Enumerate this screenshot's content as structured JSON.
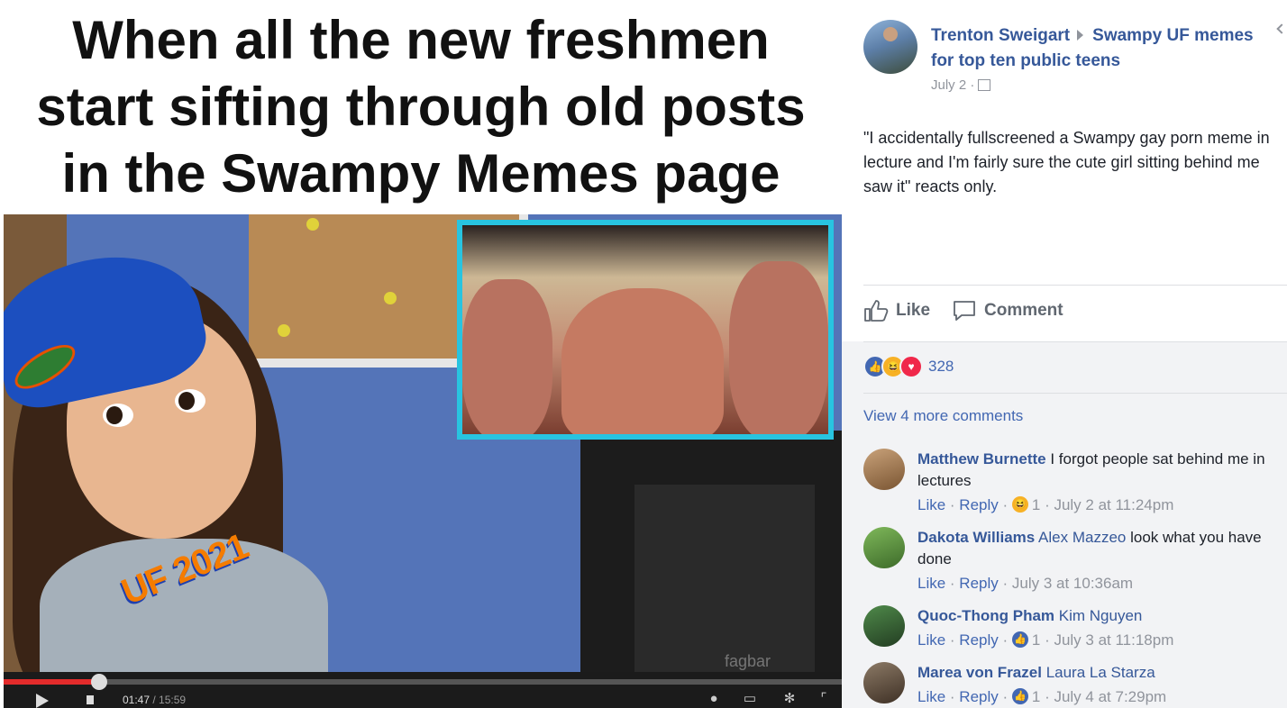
{
  "meme": {
    "caption_lines": [
      "When all the new freshmen",
      "start sifting through old posts",
      "in the Swampy Memes page"
    ],
    "shirt_text": "UF 2021",
    "watermark": "fagbar",
    "video": {
      "current_time": "01:47",
      "duration": "/ 15:59",
      "progress": 0.114
    }
  },
  "post": {
    "author": "Trenton Sweigart",
    "group": "Swampy UF memes for top ten public teens",
    "date": "July 2 ·",
    "text": "\"I accidentally fullscreened a Swampy gay porn meme in lecture and I'm fairly sure the cute girl sitting behind me saw it\" reacts only.",
    "actions": {
      "like": "Like",
      "comment": "Comment"
    },
    "reaction_count": "328",
    "reaction_icons": [
      "like-reaction-icon",
      "haha-reaction-icon",
      "love-reaction-icon"
    ],
    "view_more": "View 4 more comments"
  },
  "colors": {
    "link": "#365899",
    "accent": "#4267b2",
    "meta": "#90949c",
    "like_blue": "#4267b2",
    "love_red": "#f0284a",
    "haha_yellow": "#f7b125"
  },
  "comments": [
    {
      "name": "Matthew Burnette",
      "tag": "",
      "text": "I forgot people sat behind me in lectures",
      "like": "Like",
      "reply": "Reply",
      "reaction": "haha",
      "reaction_count": "1",
      "time": "July 2 at 11:24pm"
    },
    {
      "name": "Dakota Williams",
      "tag": "Alex Mazzeo",
      "text": "look what you have done",
      "like": "Like",
      "reply": "Reply",
      "reaction": "",
      "reaction_count": "",
      "time": "July 3 at 10:36am"
    },
    {
      "name": "Quoc-Thong Pham",
      "tag": "Kim Nguyen",
      "text": "",
      "like": "Like",
      "reply": "Reply",
      "reaction": "like",
      "reaction_count": "1",
      "time": "July 3 at 11:18pm"
    },
    {
      "name": "Marea von Frazel",
      "tag": "Laura La Starza",
      "text": "",
      "like": "Like",
      "reply": "Reply",
      "reaction": "like",
      "reaction_count": "1",
      "time": "July 4 at 7:29pm"
    }
  ]
}
